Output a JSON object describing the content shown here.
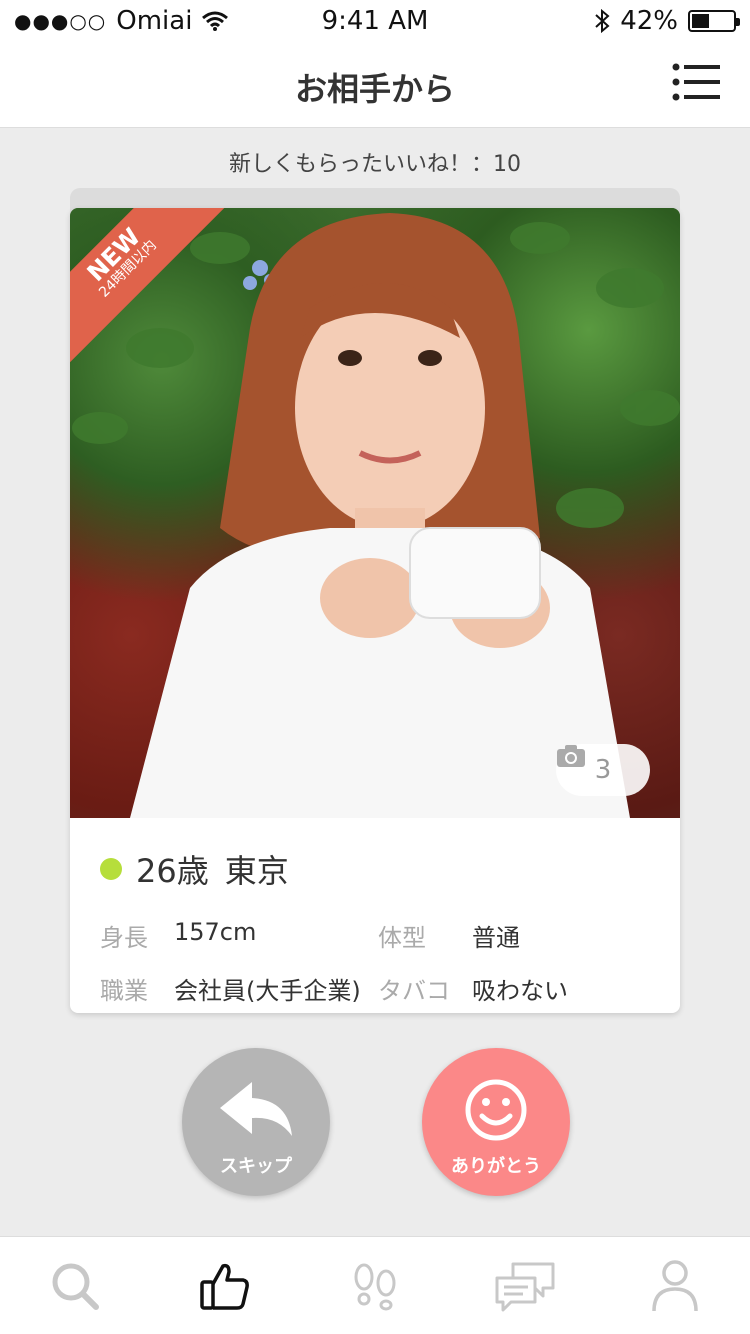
{
  "status_bar": {
    "signal": "●●●○○",
    "carrier": "Omiai",
    "time": "9:41 AM",
    "battery_percent": "42%",
    "battery_level": 0.42
  },
  "nav": {
    "title": "お相手から"
  },
  "counter": {
    "text": "新しくもらったいいね！：10"
  },
  "card": {
    "ribbon_new": "NEW",
    "ribbon_sub": "24時間以内",
    "photo_count": "3",
    "age": "26歳",
    "location": "東京",
    "details": [
      {
        "key": "身長",
        "value": "157cm"
      },
      {
        "key": "体型",
        "value": "普通"
      },
      {
        "key": "職業",
        "value": "会社員(大手企業)"
      },
      {
        "key": "タバコ",
        "value": "吸わない"
      }
    ]
  },
  "actions": {
    "skip_label": "スキップ",
    "thanks_label": "ありがとう"
  },
  "colors": {
    "online": "#b6de3b",
    "skip": "#b5b5b5",
    "thanks": "#fb8888",
    "ribbon": "#e0634b"
  },
  "tabs": [
    {
      "icon": "search-icon"
    },
    {
      "icon": "thumbs-up-icon",
      "active": true
    },
    {
      "icon": "footprints-icon"
    },
    {
      "icon": "messages-icon"
    },
    {
      "icon": "profile-icon"
    }
  ]
}
